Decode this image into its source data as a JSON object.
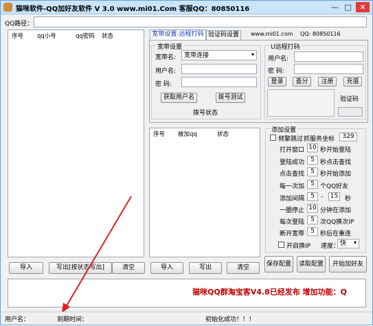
{
  "window": {
    "title": "猫咪软件-QQ加好友软件 V 3.0 www.mi01.Com 客服QQ：80850116",
    "minimize": "—",
    "maximize": "□",
    "close": "✕"
  },
  "qq_path": {
    "label": "QQ路径：",
    "value": ""
  },
  "left_table": {
    "columns": [
      "序号",
      "qq小号",
      "qq密码",
      "状态"
    ]
  },
  "tabs": [
    "宽带设置-远程打码",
    "验证码设置"
  ],
  "site_text": "www.mi01.com",
  "qq_text": "QQ: 80850116",
  "broadband": {
    "group_title": "宽带设置",
    "name_label": "宽带名:",
    "name_value": "宽带连接",
    "user_label": "用户名:",
    "pass_label": "密  码:",
    "get_user_button": "获取用户名",
    "test_button": "拨号测试",
    "dial_status": "拨号状态"
  },
  "remote_captcha": {
    "group_title": "U远程打码",
    "user_label": "用户名:",
    "pass_label": "密  码:",
    "buttons": [
      "登录",
      "查分",
      "注册",
      "充值"
    ],
    "captcha_label": "验证码"
  },
  "middle_table": {
    "columns": [
      "序号",
      "被加qq",
      "状态"
    ]
  },
  "add_settings": {
    "group_title": "添加设置",
    "frequent_skip": "频繁跳过",
    "coord_label": "抓服务坐标",
    "coord_value": "329",
    "rows": [
      {
        "left": "打开窗口",
        "value": "10",
        "right": "秒开始登陆"
      },
      {
        "left": "登陆成功",
        "value": "5",
        "right": "秒点击查找"
      },
      {
        "left": "点击查找",
        "value": "5",
        "right": "秒开始添加"
      },
      {
        "left": "每一次加",
        "value": "5",
        "right": "个QQ好友"
      },
      {
        "left": "添加间隔",
        "value": "5",
        "right": "秒"
      },
      {
        "left": "一圈停止",
        "value": "10",
        "right": "分钟在添加"
      },
      {
        "left": "每次登陆",
        "value": "5",
        "right": "次QQ换次IP"
      },
      {
        "left": "断开宽带",
        "value": "5",
        "right": "秒后在重连"
      }
    ],
    "interval_dash": "-",
    "interval_value2": "15",
    "open_ip": "开启换IP",
    "speed_label": "速度：",
    "speed_value": "快"
  },
  "bottom_buttons": {
    "left": [
      "导入",
      "写出[按状态写出]",
      "清空"
    ],
    "middle": [
      "导入",
      "写出",
      "清空"
    ],
    "right": [
      "保存配置",
      "读取配置",
      "开始加好友"
    ]
  },
  "marquee_text": "猫咪QQ群淘宝客V4.8已经发布 增加功能：Q",
  "status_bar": {
    "user_label": "用户名：",
    "expire_label": "到期时间：",
    "init_status": "初始化成功！！！"
  }
}
